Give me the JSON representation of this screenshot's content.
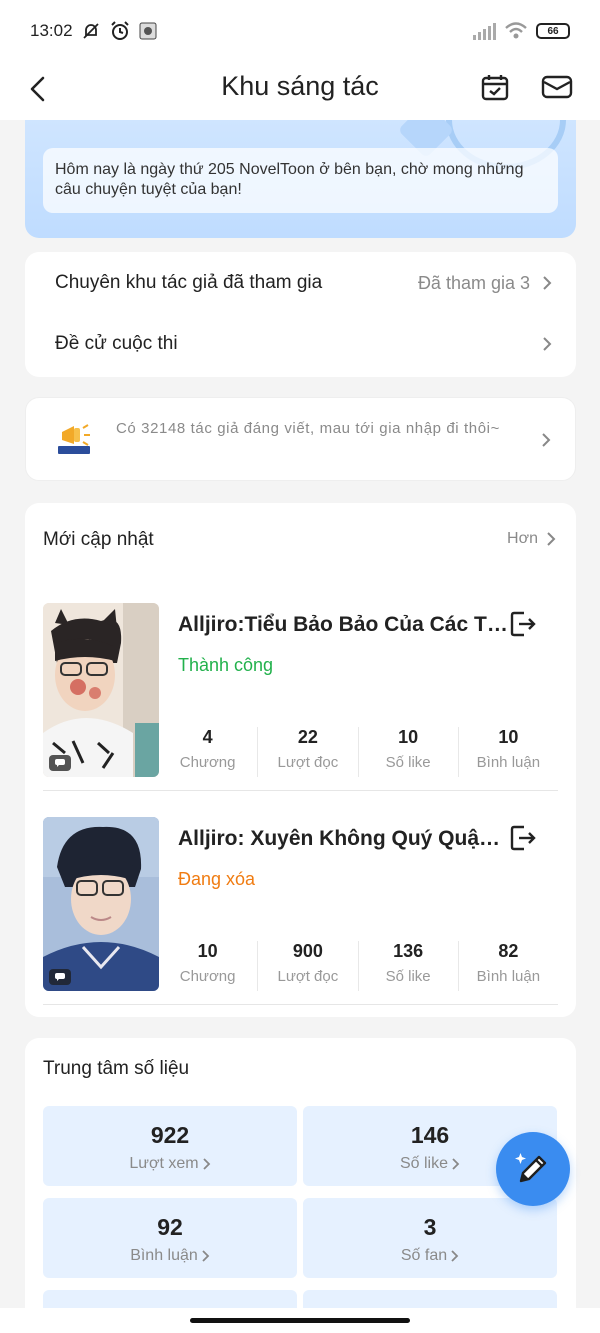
{
  "status_bar": {
    "time": "13:02",
    "battery": "66"
  },
  "header": {
    "title": "Khu sáng tác",
    "icons": [
      "back-icon",
      "calendar-check-icon",
      "mail-icon"
    ]
  },
  "banner": {
    "message": "Hôm nay là ngày thứ 205 NovelToon ở bên bạn, chờ mong những câu chuyện tuyệt của bạn!"
  },
  "menu": {
    "zones_label": "Chuyên khu tác giả đã tham gia",
    "zones_value": "Đã tham gia 3",
    "contest_label": "Đề cử cuộc thi"
  },
  "promo": {
    "text": "Có 32148 tác giả đáng viết, mau tới gia nhập đi thôi~"
  },
  "updates": {
    "title": "Mới cập nhật",
    "more_label": "Hơn",
    "books": [
      {
        "title": "Alljiro:Tiểu Bảo Bảo Của Các Th...",
        "status": "Thành công",
        "status_color": "#22b14c",
        "stats": [
          {
            "value": "4",
            "label": "Chương"
          },
          {
            "value": "22",
            "label": "Lượt đọc"
          },
          {
            "value": "10",
            "label": "Số like"
          },
          {
            "value": "10",
            "label": "Bình luận"
          }
        ]
      },
      {
        "title": "Alljiro: Xuyên Không Quý Quậy ...",
        "status": "Đang xóa",
        "status_color": "#f07c12",
        "stats": [
          {
            "value": "10",
            "label": "Chương"
          },
          {
            "value": "900",
            "label": "Lượt đọc"
          },
          {
            "value": "136",
            "label": "Số like"
          },
          {
            "value": "82",
            "label": "Bình luận"
          }
        ]
      }
    ]
  },
  "data_center": {
    "title": "Trung tâm số liệu",
    "tiles": [
      {
        "value": "922",
        "label": "Lượt xem"
      },
      {
        "value": "146",
        "label": "Số like"
      },
      {
        "value": "92",
        "label": "Bình luận"
      },
      {
        "value": "3",
        "label": "Số fan"
      }
    ]
  },
  "colors": {
    "accent": "#3a8cf0",
    "success": "#22b14c",
    "warning": "#f07c12"
  }
}
